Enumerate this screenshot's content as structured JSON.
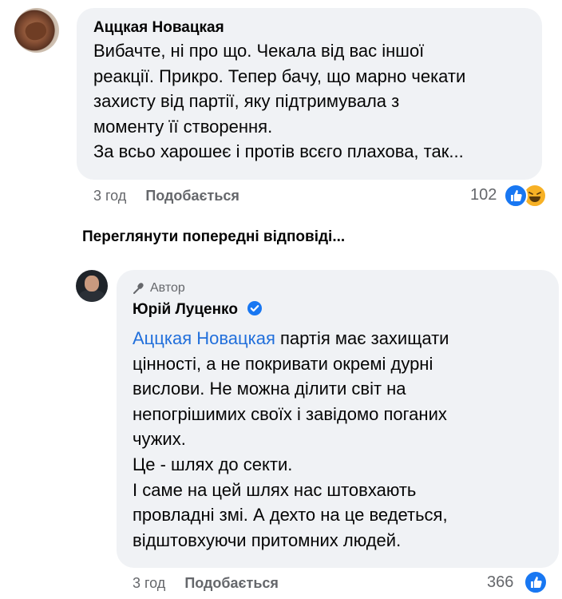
{
  "comment1": {
    "author": "Аццкая Новацкая",
    "lines": [
      "Вибачте, ні про що. Чекала від вас іншої",
      "реакції. Прикро. Тепер бачу, що марно чекати",
      "захисту від партії, яку підтримувала з",
      "моменту її створення.",
      "За всьо харошеє і протів всєго плахова, так..."
    ],
    "time": "3 год",
    "like_label": "Подобається",
    "reaction_count": "102",
    "reactions": [
      "like-icon",
      "laugh-icon"
    ]
  },
  "view_previous_label": "Переглянути попередні відповіді...",
  "reply": {
    "badge_label": "Автор",
    "badge_icon": "microphone-icon",
    "author": "Юрій Луценко",
    "verified": true,
    "mention": "Аццкая Новацкая",
    "line1_rest": " партія має захищати",
    "lines": [
      "цінності, а не покривати окремі дурні",
      "вислови. Не можна ділити світ на",
      "непогрішимих своїх і завідомо поганих",
      "чужих.",
      "Це - шлях до секти.",
      "І саме на цей шлях нас штовхають",
      "провладні змі. А дехто на це ведеться,",
      "відштовхуючи притомних людей."
    ],
    "time": "3 год",
    "like_label": "Подобається",
    "reaction_count": "366",
    "reactions": [
      "like-icon"
    ]
  },
  "colors": {
    "bubble": "#f0f2f5",
    "text": "#050505",
    "secondary": "#65676b",
    "mention": "#216fdb",
    "like": "#1877f2",
    "laugh": "#f7b125"
  }
}
